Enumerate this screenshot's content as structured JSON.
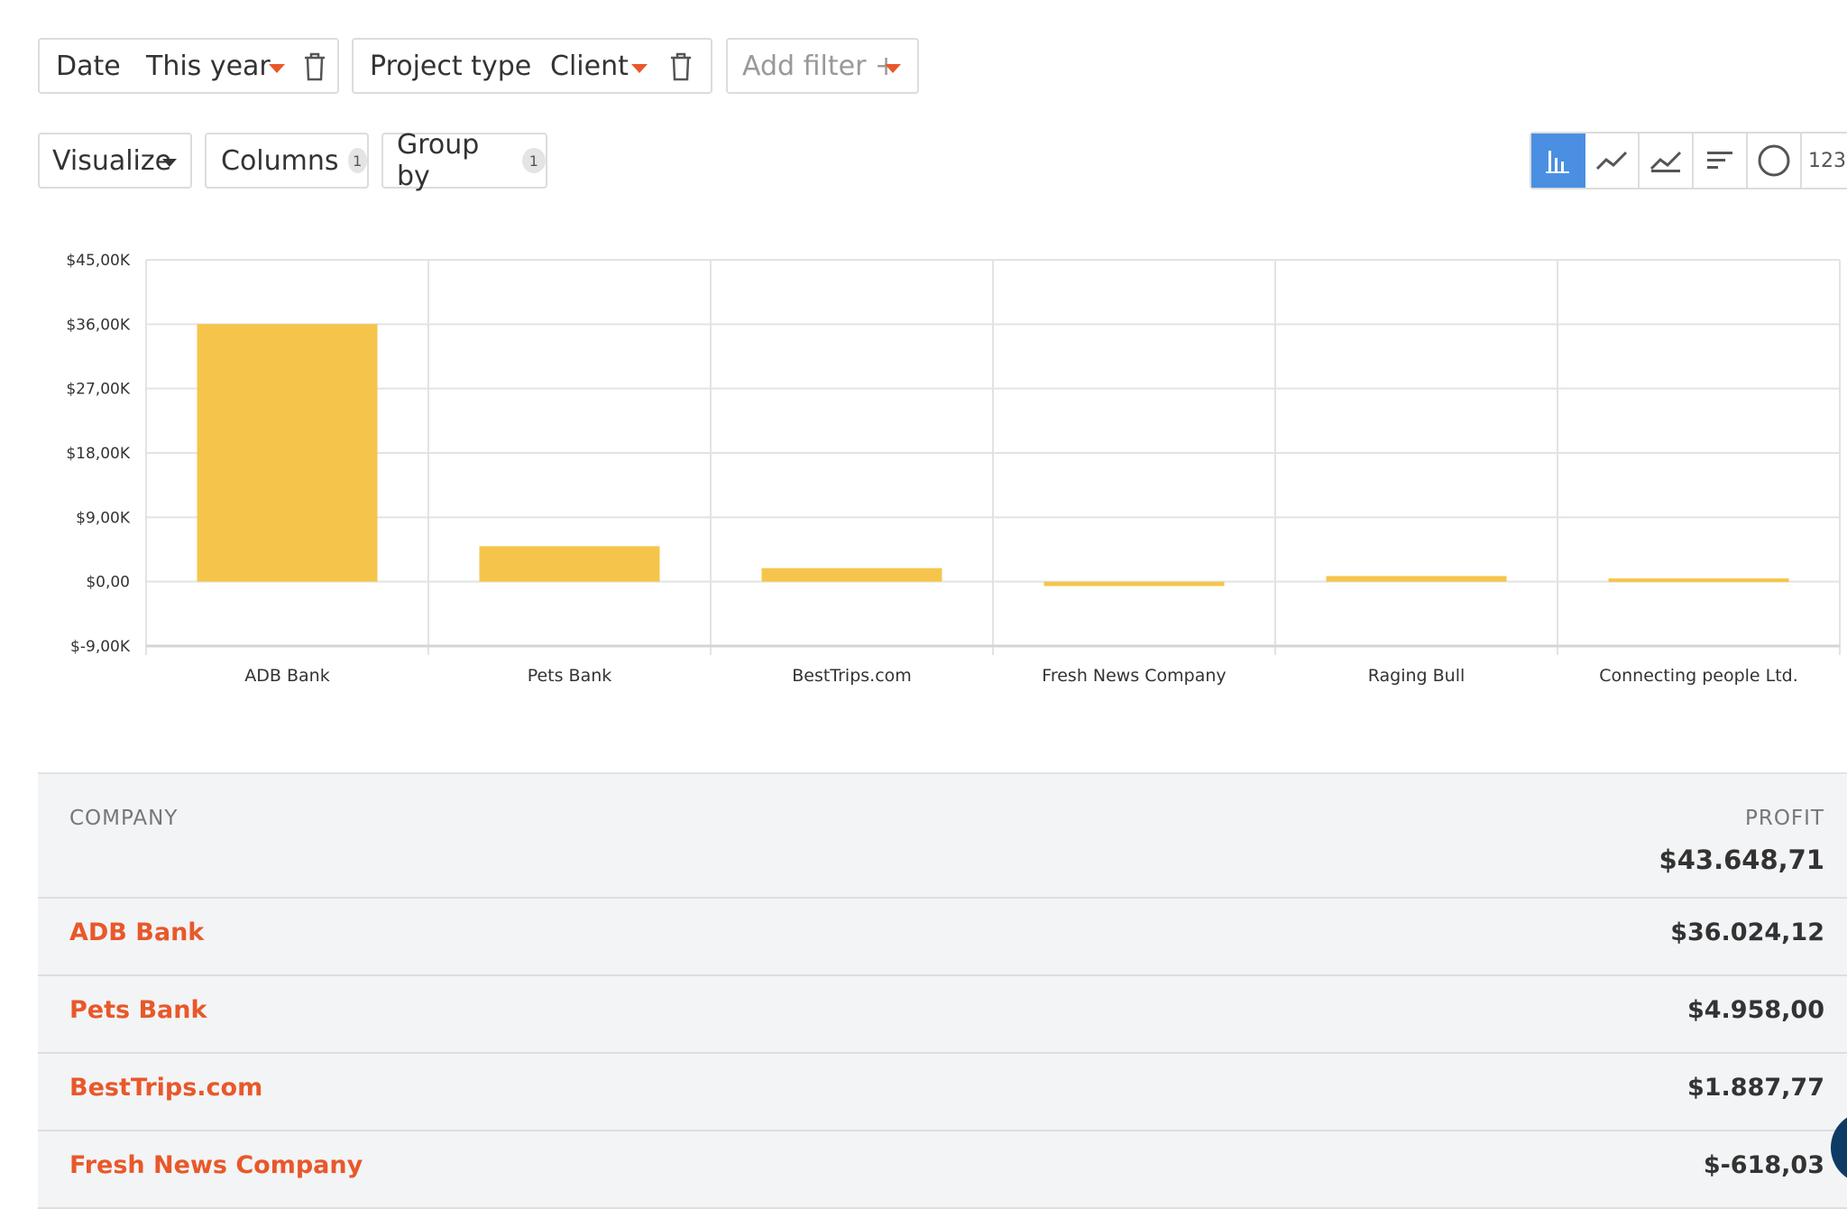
{
  "filters": {
    "date": {
      "label": "Date",
      "value": "This year"
    },
    "project_type": {
      "label": "Project type",
      "value": "Client"
    },
    "add_filter": "Add filter +"
  },
  "toolbar": {
    "visualize": "Visualize",
    "columns": {
      "label": "Columns",
      "count": "1"
    },
    "group_by": {
      "label": "Group by",
      "count": "1"
    },
    "chart_types": [
      "bar-chart-icon",
      "line-chart-icon",
      "area-chart-icon",
      "horizontal-bar-icon",
      "pie-chart-icon",
      "number-icon"
    ],
    "number_label": "123",
    "active_chart_type": "bar-chart-icon"
  },
  "colors": {
    "bar": "#f5c54b",
    "accent": "#e8582a",
    "active": "#4a8fe2"
  },
  "chart_data": {
    "type": "bar",
    "categories": [
      "ADB Bank",
      "Pets Bank",
      "BestTrips.com",
      "Fresh News Company",
      "Raging Bull",
      "Connecting people Ltd."
    ],
    "values": [
      36024.12,
      4958.0,
      1887.77,
      -618.03,
      780,
      450
    ],
    "yticks": [
      45000,
      36000,
      27000,
      18000,
      9000,
      0,
      -9000
    ],
    "ytick_labels": [
      "$45,00K",
      "$36,00K",
      "$27,00K",
      "$18,00K",
      "$9,00K",
      "$0,00",
      "$-9,00K"
    ],
    "ylim": [
      -9000,
      45000
    ],
    "title": "",
    "xlabel": "",
    "ylabel": "",
    "grid": true
  },
  "table": {
    "headers": {
      "company": "COMPANY",
      "profit": "PROFIT"
    },
    "total": "$43.648,71",
    "rows": [
      {
        "company": "ADB Bank",
        "profit": "$36.024,12"
      },
      {
        "company": "Pets Bank",
        "profit": "$4.958,00"
      },
      {
        "company": "BestTrips.com",
        "profit": "$1.887,77"
      },
      {
        "company": "Fresh News Company",
        "profit": "$-618,03"
      }
    ]
  }
}
